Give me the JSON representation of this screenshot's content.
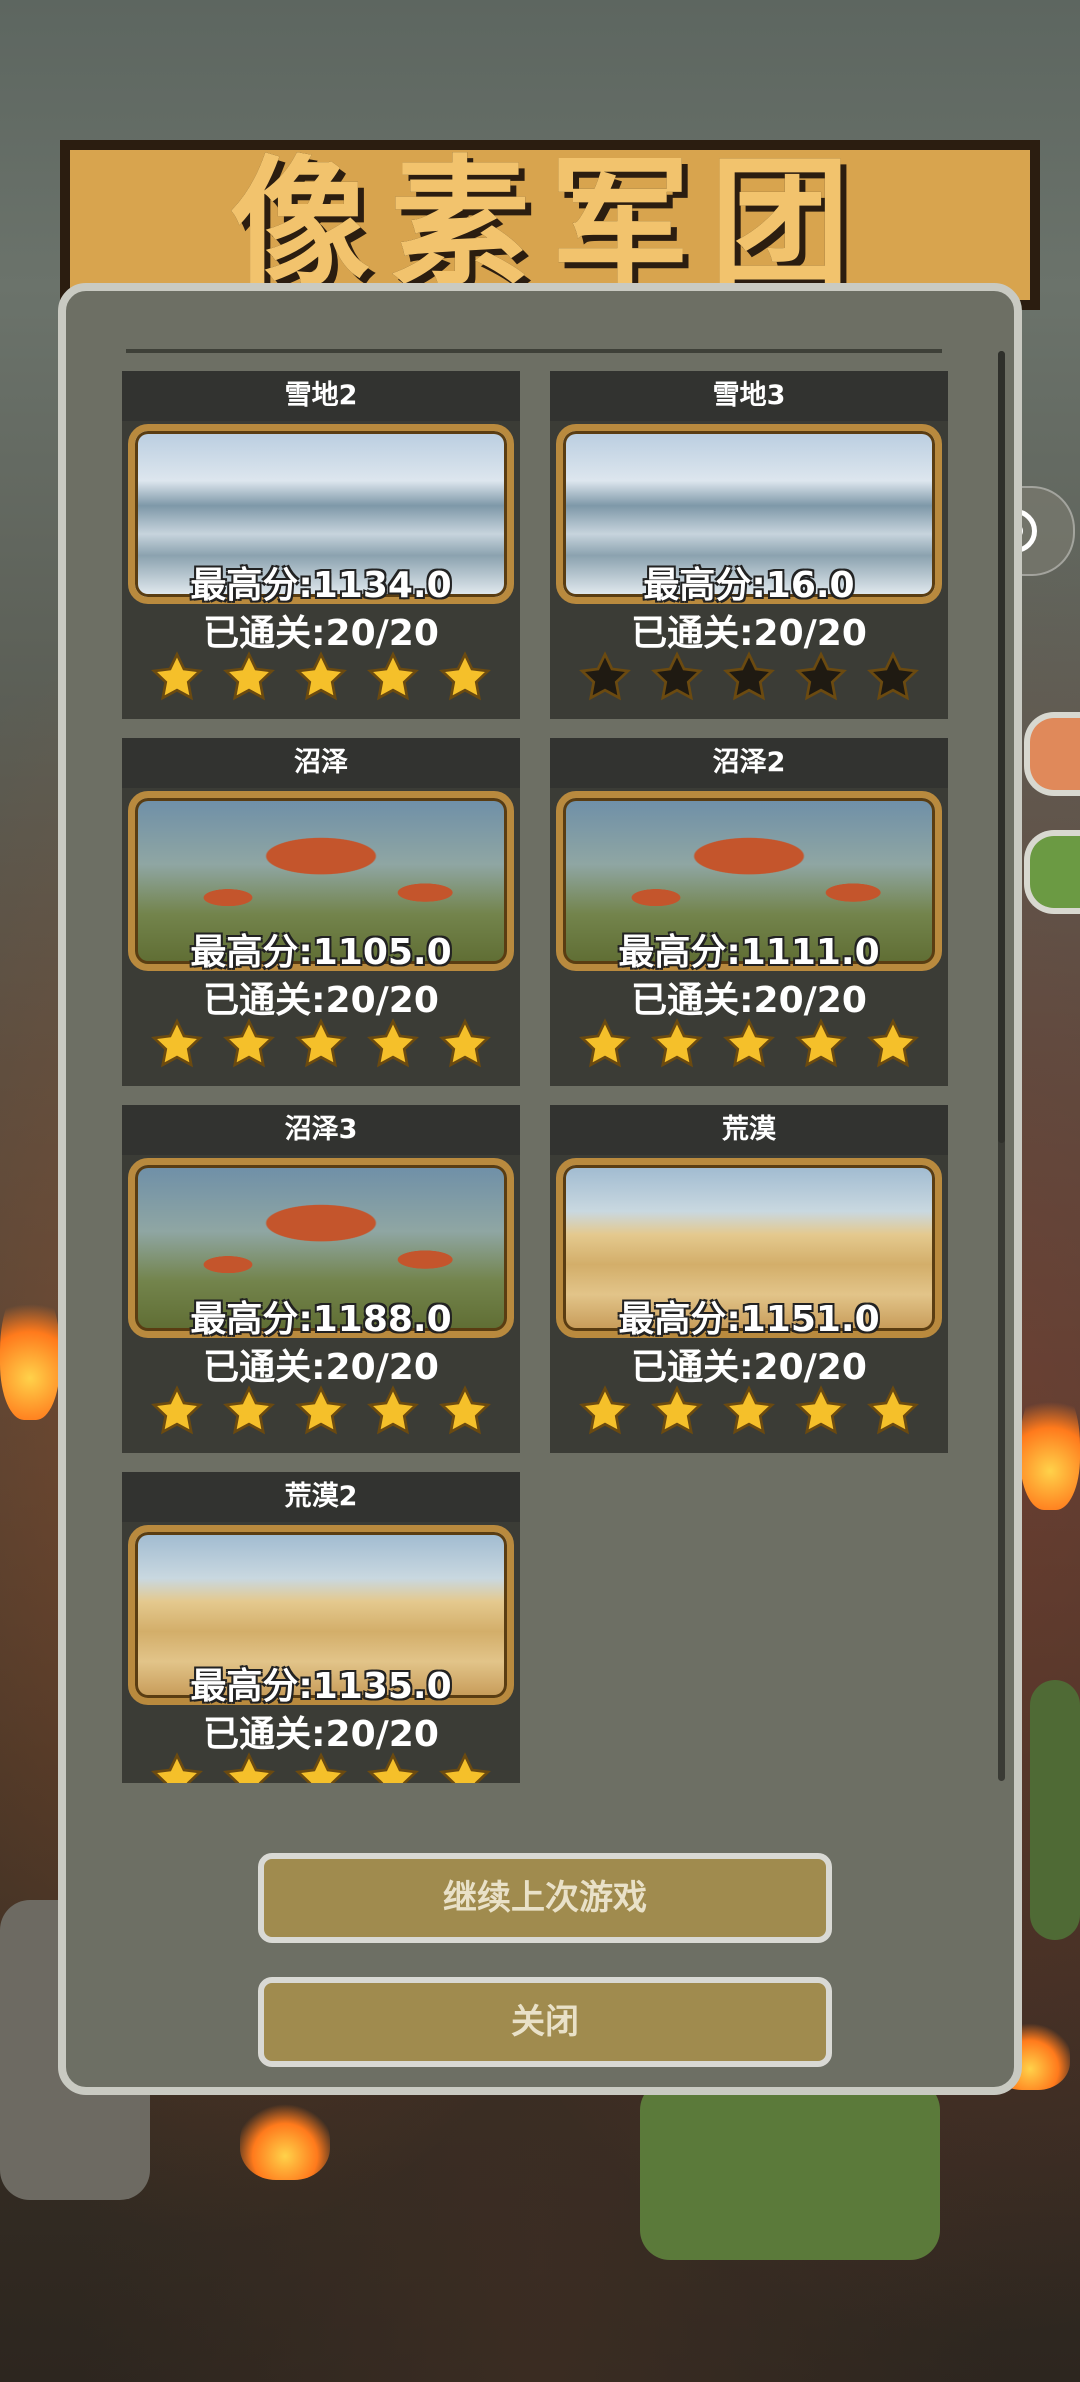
{
  "game_title": "像素军团",
  "capsule": {
    "more_icon": "more-dots-icon",
    "close_icon": "target-circle-icon"
  },
  "levels": [
    {
      "name": "雪地2",
      "terrain": "snow",
      "best_score": "最高分:1134.0",
      "progress": "已通关:20/20",
      "stars_earned": 5
    },
    {
      "name": "雪地3",
      "terrain": "snow",
      "best_score": "最高分:16.0",
      "progress": "已通关:20/20",
      "stars_earned": 0
    },
    {
      "name": "沼泽",
      "terrain": "swamp",
      "best_score": "最高分:1105.0",
      "progress": "已通关:20/20",
      "stars_earned": 5
    },
    {
      "name": "沼泽2",
      "terrain": "swamp",
      "best_score": "最高分:1111.0",
      "progress": "已通关:20/20",
      "stars_earned": 5
    },
    {
      "name": "沼泽3",
      "terrain": "swamp",
      "best_score": "最高分:1188.0",
      "progress": "已通关:20/20",
      "stars_earned": 5
    },
    {
      "name": "荒漠",
      "terrain": "desert",
      "best_score": "最高分:1151.0",
      "progress": "已通关:20/20",
      "stars_earned": 5
    },
    {
      "name": "荒漠2",
      "terrain": "desert",
      "best_score": "最高分:1135.0",
      "progress": "已通关:20/20",
      "stars_earned": 5
    }
  ],
  "buttons": {
    "continue": "继续上次游戏",
    "close": "关闭"
  },
  "colors": {
    "star_gold": "#f5c02a",
    "star_empty": "#1f1a12",
    "button_bg": "#a08b4e",
    "panel_bg": "#6d6f64"
  }
}
